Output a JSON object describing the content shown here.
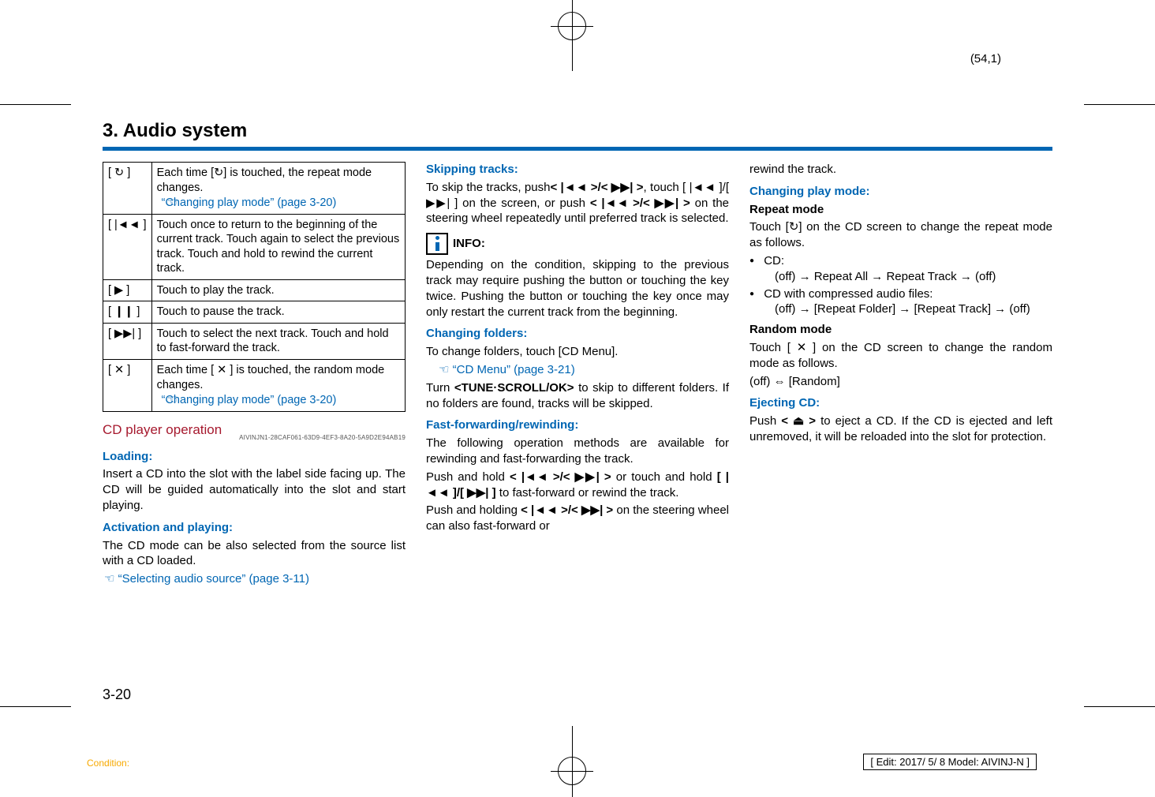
{
  "coord": "(54,1)",
  "section_title": "3. Audio system",
  "table": {
    "rows": [
      {
        "icon": "[ ↻ ]",
        "name": "repeat-icon-cell",
        "text_a": "Each time [↻] is touched, the repeat mode changes.",
        "ref": "“Changing play mode” (page 3-20)"
      },
      {
        "icon": "[ |◄◄ ]",
        "name": "prev-track-icon-cell",
        "text_a": "Touch once to return to the beginning of the current track. Touch again to select the previous track. Touch and hold to rewind the current track."
      },
      {
        "icon": "[   ▶  ]",
        "name": "play-icon-cell",
        "text_a": "Touch to play the track."
      },
      {
        "icon": "[   ❙❙   ]",
        "name": "pause-icon-cell",
        "text_a": "Touch to pause the track."
      },
      {
        "icon": "[ ▶▶| ]",
        "name": "next-track-icon-cell",
        "text_a": "Touch to select the next track. Touch and hold to fast-forward the track."
      },
      {
        "icon": "[ ✕ ]",
        "name": "shuffle-icon-cell",
        "text_a": "Each time [ ✕ ] is touched, the random mode changes.",
        "ref": "“Changing play mode” (page 3-20)"
      }
    ]
  },
  "cd_op_title": "CD player operation",
  "cd_op_id": "AIVINJN1-28CAF061-63D9-4EF3-8A20-5A9D2E94AB19",
  "c1": {
    "loading_h": "Loading:",
    "loading_p": "Insert a CD into the slot with the label side facing up. The CD will be guided automatically into the slot and start playing.",
    "activ_h": "Activation and playing:",
    "activ_p": "The CD mode can be also selected from the source list with a CD loaded.",
    "activ_ref": "“Selecting audio source” (page 3-11)"
  },
  "c2": {
    "skip_h": "Skipping tracks:",
    "skip_p1": "To skip the tracks, push",
    "skip_btn1": "< |◄◄ >/< ▶▶| >",
    "skip_p2": ", touch [ |◄◄ ]/[ ▶▶| ] on the screen, or push",
    "skip_btn2": "< |◄◄ >/< ▶▶| >",
    "skip_p3": " on the steering wheel repeatedly until preferred track is selected.",
    "info_label": "INFO:",
    "info_p": "Depending on the condition, skipping to the previous track may require pushing the button or touching the key twice. Pushing the button or touching the key once may only restart the current track from the beginning.",
    "fold_h": "Changing folders:",
    "fold_p": "To change folders, touch [CD Menu].",
    "fold_ref": "“CD Menu” (page 3-21)",
    "fold_p2a": "Turn ",
    "fold_btn": "<TUNE·SCROLL/OK>",
    "fold_p2b": " to skip to different folders. If no folders are found, tracks will be skipped.",
    "ff_h": "Fast-forwarding/rewinding:",
    "ff_p1": "The following operation methods are available for rewinding and fast-forwarding the track.",
    "ff_p2a": "Push and hold ",
    "ff_btn1": "< |◄◄ >/< ▶▶| >",
    "ff_p2b": " or touch and hold ",
    "ff_btn2": "[ |◄◄ ]/[ ▶▶| ]",
    "ff_p2c": " to fast-forward or rewind the track.",
    "ff_p3a": "Push and holding ",
    "ff_btn3": "< |◄◄ >/< ▶▶| >",
    "ff_p3b": " on the steering wheel can also fast-forward or "
  },
  "c3": {
    "top": "rewind the track.",
    "cpm_h": "Changing play mode:",
    "rep_h": "Repeat mode",
    "rep_p": "Touch [↻] on the CD screen to change the repeat mode as follows.",
    "b1": "CD:",
    "b1s": "(off) → Repeat All → Repeat Track → (off)",
    "b2": "CD with compressed audio files:",
    "b2s": "(off) → [Repeat Folder] → [Repeat Track] → (off)",
    "rand_h": "Random mode",
    "rand_p": "Touch [ ✕ ] on the CD screen to change the random mode as follows.",
    "rand_p2": "(off) ⇔ [Random]",
    "ej_h": "Ejecting CD:",
    "ej_p_a": "Push ",
    "ej_btn": "< ⏏ >",
    "ej_p_b": " to eject a CD. If the CD is ejected and left unremoved, it will be reloaded into the slot for protection."
  },
  "page_num": "3-20",
  "footer_cond": "Condition:",
  "footer_edit": "[ Edit: 2017/ 5/ 8    Model:  AIVINJ-N ]"
}
